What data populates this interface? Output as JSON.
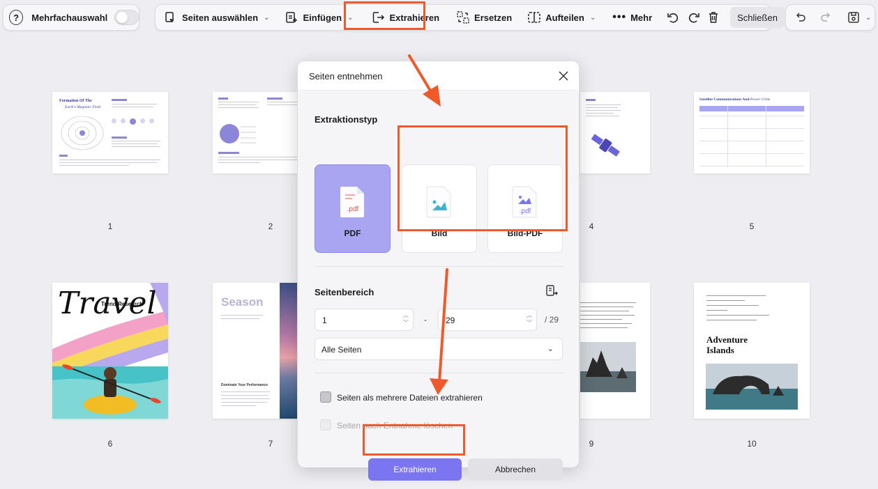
{
  "toolbar": {
    "multi_select_label": "Mehrfachauswahl",
    "select_pages_label": "Seiten auswählen",
    "insert_label": "Einfügen",
    "extract_label": "Extrahieren",
    "replace_label": "Ersetzen",
    "split_label": "Aufteilen",
    "more_label": "Mehr",
    "close_label": "Schließen"
  },
  "pages": [
    {
      "number": "1",
      "title_line1": "Formation Of The",
      "title_line2": "Earth's Magnetic Field"
    },
    {
      "number": "2"
    },
    {
      "number": "4"
    },
    {
      "number": "5",
      "title_a": "Satellite Communications And",
      "title_b": "Power Grids"
    },
    {
      "number": "6",
      "title": "Travel",
      "subtitle": "Trend Research"
    },
    {
      "number": "7",
      "title": "Season",
      "subtitle": "Dominate Your Performance"
    },
    {
      "number": "9"
    },
    {
      "number": "10",
      "title_line1": "Adventure",
      "title_line2": "Islands"
    }
  ],
  "dialog": {
    "title": "Seiten entnehmen",
    "extraction_type_title": "Extraktionstyp",
    "types": [
      {
        "label": "PDF",
        "icon_text": ".pdf",
        "selected": true
      },
      {
        "label": "Bild",
        "selected": false
      },
      {
        "label": "Bild-PDF",
        "icon_text": ".pdf",
        "selected": false
      }
    ],
    "page_range_title": "Seitenbereich",
    "range_from": "1",
    "range_separator": "-",
    "range_to": "29",
    "range_total": "/ 29",
    "range_option": "Alle Seiten",
    "checkbox_multi_files": "Seiten als mehrere Dateien extrahieren",
    "checkbox_delete_after": "Seiten nach Entnahme löschen",
    "extract_button": "Extrahieren",
    "cancel_button": "Abbrechen"
  },
  "colors": {
    "accent": "#7b75f2",
    "selected_card": "#a8a6f0",
    "annotation": "#f0592a"
  }
}
